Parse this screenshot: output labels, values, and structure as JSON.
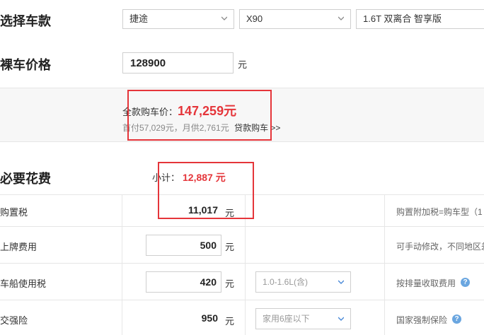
{
  "select_car": {
    "title": "选择车款",
    "brand": "捷途",
    "model": "X90",
    "trim": "1.6T 双离合 智享版"
  },
  "bare_price": {
    "title": "裸车价格",
    "value": "128900",
    "unit": "元"
  },
  "full_price": {
    "label": "全款购车价：",
    "value": "147,259元",
    "loan_info": "首付57,029元，月供2,761元",
    "loan_link": "贷款购车 >>"
  },
  "required_fees": {
    "title": "必要花费",
    "subtotal_label": "小计：",
    "subtotal_value": "12,887 元",
    "rows": [
      {
        "label": "购置税",
        "value": "11,017",
        "unit": "元",
        "note": "购置附加税=购车型（1"
      },
      {
        "label": "上牌费用",
        "value": "500",
        "unit": "元",
        "note": "可手动修改，不同地区差"
      },
      {
        "label": "车船使用税",
        "value": "420",
        "unit": "元",
        "option": "1.0-1.6L(含)",
        "note": "按排量收取费用"
      },
      {
        "label": "交强险",
        "value": "950",
        "unit": "元",
        "option": "家用6座以下",
        "note": "国家强制保险"
      }
    ]
  },
  "colors": {
    "accent_red": "#e5353a",
    "help_blue": "#6aa6e0"
  }
}
